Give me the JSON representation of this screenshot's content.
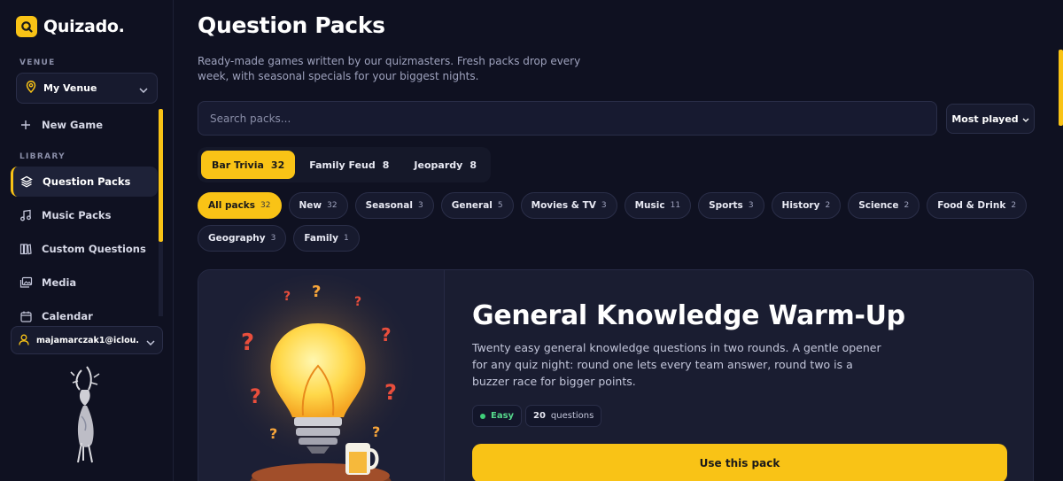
{
  "app": {
    "name": "Quizado."
  },
  "sidebar": {
    "venue_label": "VENUE",
    "venue_value": "My Venue",
    "new_game": "New Game",
    "library_label": "LIBRARY",
    "items": [
      {
        "label": "Question Packs",
        "icon": "stack-icon"
      },
      {
        "label": "Music Packs",
        "icon": "music-note-icon"
      },
      {
        "label": "Custom Questions",
        "icon": "book-icon"
      },
      {
        "label": "Media",
        "icon": "images-icon"
      },
      {
        "label": "Calendar",
        "icon": "calendar-icon"
      }
    ],
    "account": "majamarczak1@iclou..."
  },
  "main": {
    "title": "Question Packs",
    "subtitle": "Ready-made games written by our quizmasters. Fresh packs drop every week, with seasonal specials for your biggest nights.",
    "search_placeholder": "Search packs...",
    "sort_label": "Most played",
    "tabs": [
      {
        "label": "Bar Trivia",
        "count": "32"
      },
      {
        "label": "Family Feud",
        "count": "8"
      },
      {
        "label": "Jeopardy",
        "count": "8"
      }
    ],
    "chips": [
      {
        "label": "All packs",
        "count": "32"
      },
      {
        "label": "New",
        "count": "32"
      },
      {
        "label": "Seasonal",
        "count": "3"
      },
      {
        "label": "General",
        "count": "5"
      },
      {
        "label": "Movies & TV",
        "count": "3"
      },
      {
        "label": "Music",
        "count": "11"
      },
      {
        "label": "Sports",
        "count": "3"
      },
      {
        "label": "History",
        "count": "2"
      },
      {
        "label": "Science",
        "count": "2"
      },
      {
        "label": "Food & Drink",
        "count": "2"
      },
      {
        "label": "Geography",
        "count": "3"
      },
      {
        "label": "Family",
        "count": "1"
      }
    ],
    "featured": {
      "title": "General Knowledge Warm-Up",
      "description": "Twenty easy general knowledge questions in two rounds. A gentle opener for any quiz night: round one lets every team answer, round two is a buzzer race for bigger points.",
      "difficulty": "Easy",
      "question_count": "20",
      "question_unit": "questions",
      "cta": "Use this pack"
    }
  },
  "colors": {
    "accent": "#f9c316",
    "background": "#0f1121",
    "surface": "#1a1d31",
    "easy": "#3fcf7a"
  }
}
